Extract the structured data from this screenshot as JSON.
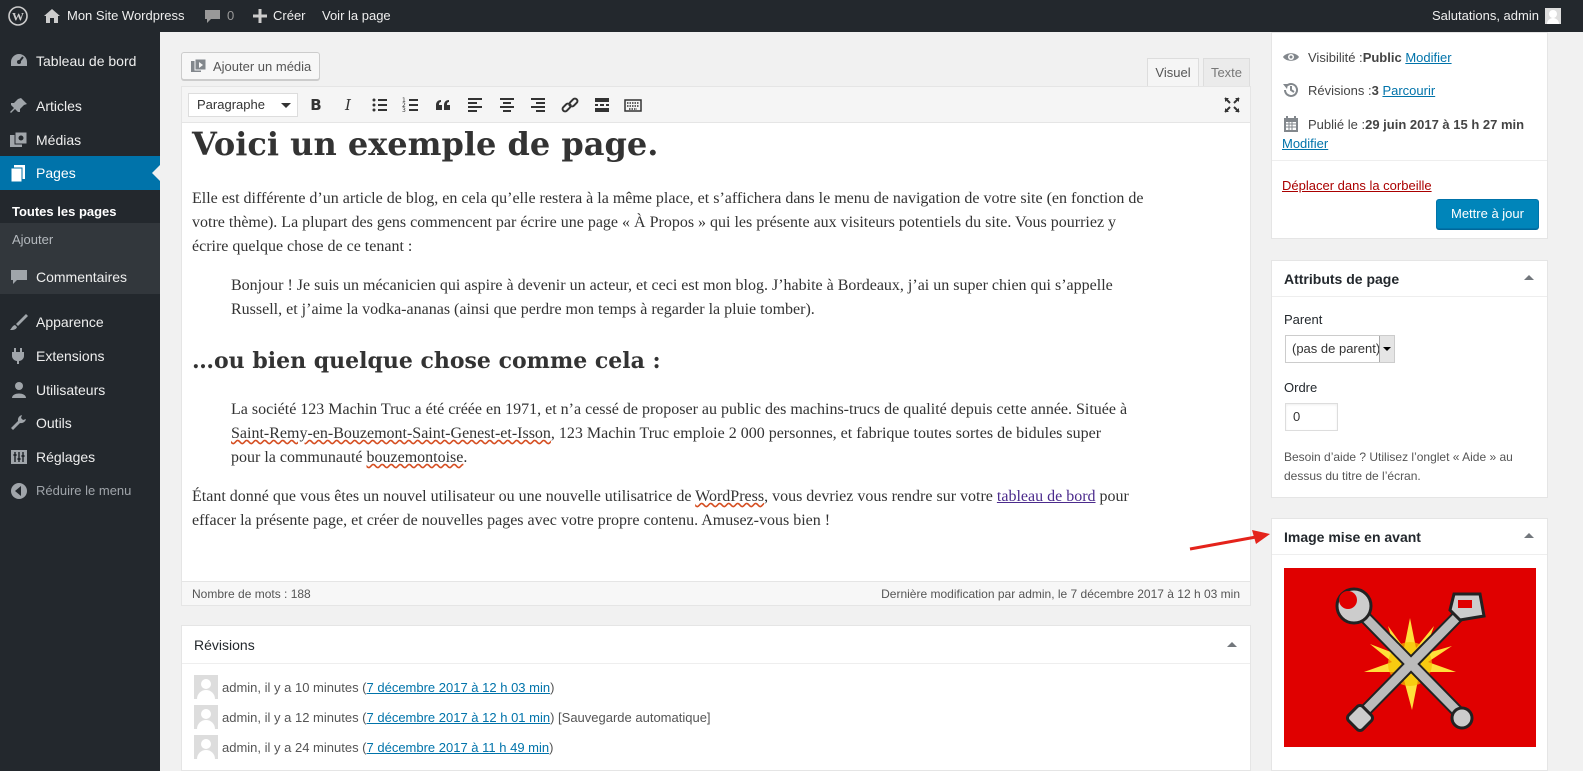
{
  "adminbar": {
    "site_name": "Mon Site Wordpress",
    "comments_count": "0",
    "new_label": "Créer",
    "view_label": "Voir la page",
    "greeting": "Salutations, admin"
  },
  "sidebar": {
    "items": [
      {
        "label": "Tableau de bord",
        "icon": "dashboard-icon"
      },
      {
        "label": "Articles",
        "icon": "pin-icon"
      },
      {
        "label": "Médias",
        "icon": "media-icon"
      },
      {
        "label": "Pages",
        "icon": "pages-icon",
        "active": true
      },
      {
        "label": "Commentaires",
        "icon": "comment-icon"
      },
      {
        "label": "Apparence",
        "icon": "brush-icon"
      },
      {
        "label": "Extensions",
        "icon": "plugin-icon"
      },
      {
        "label": "Utilisateurs",
        "icon": "users-icon"
      },
      {
        "label": "Outils",
        "icon": "wrench-icon"
      },
      {
        "label": "Réglages",
        "icon": "settings-icon"
      },
      {
        "label": "Réduire le menu",
        "icon": "collapse-icon"
      }
    ],
    "submenu": [
      "Toutes les pages",
      "Ajouter"
    ]
  },
  "editor": {
    "add_media": "Ajouter un média",
    "tab_visual": "Visuel",
    "tab_text": "Texte",
    "format": "Paragraphe",
    "h1": "Voici un exemple de page.",
    "p1_line1": "Elle est différente d’un article de blog, en cela qu’elle restera à la même place, et s’affichera dans le menu de navigation de votre site (en fonction de",
    "p1_line2": "votre thème). La plupart des gens commencent par écrire une page « À Propos » qui les présente aux visiteurs potentiels du site. Vous pourriez y",
    "p1_line3": "écrire quelque chose de ce tenant :",
    "bq1_line1": "Bonjour ! Je suis un mécanicien qui aspire à devenir un acteur, et ceci est mon blog. J’habite à Bordeaux, j’ai un super chien qui s’appelle",
    "bq1_line2": "Russell, et j’aime la vodka-ananas (ainsi que perdre mon temps à regarder la pluie tomber).",
    "h2": "…ou bien quelque chose comme cela :",
    "bq2_line1": "La société 123 Machin Truc a été créée en 1971, et n’a cessé de proposer au public des machins-trucs de qualité depuis cette année. Située à",
    "bq2_line2_link": "Saint-Remy-en-Bouzemont-Saint-Genest-et-Isson",
    "bq2_line2_rest": ", 123 Machin Truc emploie 2 000 personnes, et fabrique toutes sortes de bidules super",
    "bq2_line3_pre": "pour la communauté ",
    "bq2_line3_word": "bouzemontoise",
    "bq2_line3_post": ".",
    "p2_line1_pre": "Étant donné que vous êtes un nouvel utilisateur ou une nouvelle utilisatrice de ",
    "p2_line1_wp": "WordPress",
    "p2_line1_mid": ", vous devriez vous rendre sur votre ",
    "p2_line1_link": "tableau de bord",
    "p2_line1_post": " pour",
    "p2_line2": "effacer la présente page, et créer de nouvelles pages avec votre propre contenu. Amusez-vous bien !",
    "word_count": "Nombre de mots : 188",
    "last_modified": "Dernière modification par admin, le 7 décembre 2017 à 12 h 03 min"
  },
  "revisions": {
    "title": "Révisions",
    "items": [
      {
        "who": "admin, il y a 10 minutes (",
        "link": "7 décembre 2017 à 12 h 03 min",
        "after": ")"
      },
      {
        "who": "admin, il y a 12 minutes (",
        "link": "7 décembre 2017 à 12 h 01 min",
        "after": ") [Sauvegarde automatique]"
      },
      {
        "who": "admin, il y a 24 minutes (",
        "link": "7 décembre 2017 à 11 h 49 min",
        "after": ")"
      }
    ]
  },
  "publish": {
    "visibility_label": "Visibilité : ",
    "visibility_value": "Public",
    "visibility_link": "Modifier",
    "revisions_label": "Révisions : ",
    "revisions_value": "3",
    "revisions_link": "Parcourir",
    "published_label": "Publié le : ",
    "published_value": "29 juin 2017 à 15 h 27 min",
    "published_link": "Modifier",
    "trash": "Déplacer dans la corbeille",
    "update": "Mettre à jour"
  },
  "attributes": {
    "title": "Attributs de page",
    "parent_label": "Parent",
    "parent_value": "(pas de parent)",
    "order_label": "Ordre",
    "order_value": "0",
    "help_line1": "Besoin d’aide ? Utilisez l’onglet « Aide » au",
    "help_line2": "dessus du titre de l’écran."
  },
  "featured": {
    "title": "Image mise en avant"
  },
  "colors": {
    "accent": "#0073aa",
    "sidebar": "#23282d",
    "button": "#0085ba",
    "featured_bg": "#e00000"
  }
}
